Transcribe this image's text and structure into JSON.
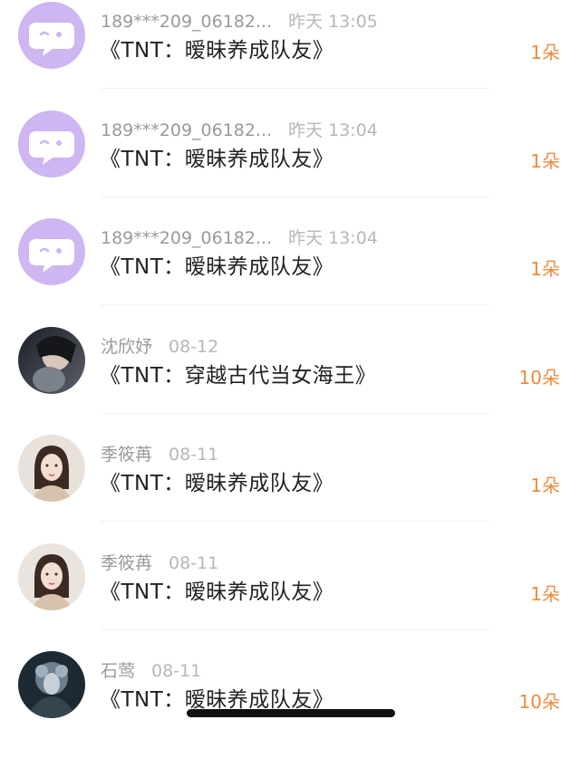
{
  "gifts": [
    {
      "user": "189***209_06182...",
      "time": "昨天 13:05",
      "title": "《TNT：暧昧养成队友》",
      "count": "1朵",
      "avatar": "default-avatar"
    },
    {
      "user": "189***209_06182...",
      "time": "昨天 13:04",
      "title": "《TNT：暧昧养成队友》",
      "count": "1朵",
      "avatar": "default-avatar"
    },
    {
      "user": "189***209_06182...",
      "time": "昨天 13:04",
      "title": "《TNT：暧昧养成队友》",
      "count": "1朵",
      "avatar": "default-avatar"
    },
    {
      "user": "沈欣妤",
      "time": "08-12",
      "title": "《TNT：穿越古代当女海王》",
      "count": "10朵",
      "avatar": "photo-avatar"
    },
    {
      "user": "季筱苒",
      "time": "08-11",
      "title": "《TNT：暧昧养成队友》",
      "count": "1朵",
      "avatar": "photo-avatar"
    },
    {
      "user": "季筱苒",
      "time": "08-11",
      "title": "《TNT：暧昧养成队友》",
      "count": "1朵",
      "avatar": "photo-avatar"
    },
    {
      "user": "石莺",
      "time": "08-11",
      "title": "《TNT：暧昧养成队友》",
      "count": "10朵",
      "avatar": "photo-avatar"
    }
  ],
  "colors": {
    "accent": "#f08a3c",
    "default_avatar_bg": "#cdb6f1",
    "username": "#9a9a9a",
    "title": "#222222"
  }
}
